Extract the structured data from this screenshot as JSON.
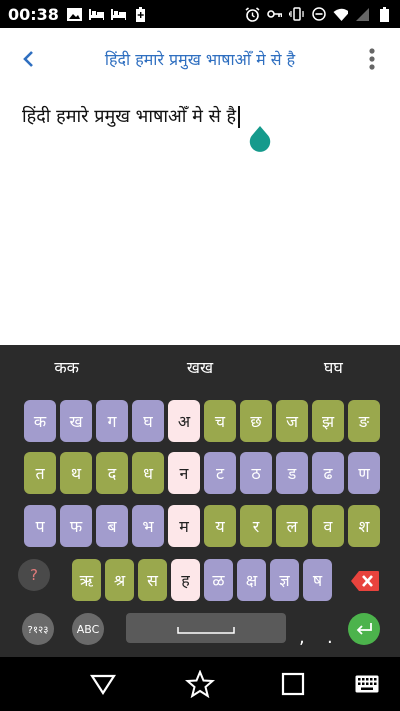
{
  "status_bar": {
    "time": "00:38",
    "left_icons": [
      "image-notification-icon",
      "bed-icon",
      "bed-icon",
      "battery-plus-icon"
    ],
    "right_icons": [
      "alarm-icon",
      "key-icon",
      "vibrate-icon",
      "do-not-disturb-icon",
      "wifi-icon",
      "no-signal-icon",
      "battery-icon"
    ]
  },
  "app_bar": {
    "title": "हिंदी हमारे प्रमुख भाषाओँ मे से है",
    "accent": "#2f6fc0"
  },
  "editor": {
    "text": "हिंदी हमारे प्रमुख भाषाओँ मे से है",
    "handle_color": "#159a8c"
  },
  "keyboard": {
    "suggestions": [
      "कक",
      "खख",
      "घघ"
    ],
    "row1": [
      {
        "label": "क",
        "color": "purple"
      },
      {
        "label": "ख",
        "color": "purple"
      },
      {
        "label": "ग",
        "color": "purple"
      },
      {
        "label": "घ",
        "color": "purple"
      },
      {
        "label": "अ",
        "color": "pink"
      },
      {
        "label": "च",
        "color": "olive"
      },
      {
        "label": "छ",
        "color": "olive"
      },
      {
        "label": "ज",
        "color": "olive"
      },
      {
        "label": "झ",
        "color": "olive"
      },
      {
        "label": "ङ",
        "color": "olive"
      }
    ],
    "row2": [
      {
        "label": "त",
        "color": "olive"
      },
      {
        "label": "थ",
        "color": "olive"
      },
      {
        "label": "द",
        "color": "olive"
      },
      {
        "label": "ध",
        "color": "olive"
      },
      {
        "label": "न",
        "color": "pink"
      },
      {
        "label": "ट",
        "color": "purple"
      },
      {
        "label": "ठ",
        "color": "purple"
      },
      {
        "label": "ड",
        "color": "purple"
      },
      {
        "label": "ढ",
        "color": "purple"
      },
      {
        "label": "ण",
        "color": "purple"
      }
    ],
    "row3": [
      {
        "label": "प",
        "color": "purple"
      },
      {
        "label": "फ",
        "color": "purple"
      },
      {
        "label": "ब",
        "color": "purple"
      },
      {
        "label": "भ",
        "color": "purple"
      },
      {
        "label": "म",
        "color": "pink"
      },
      {
        "label": "य",
        "color": "olive"
      },
      {
        "label": "र",
        "color": "olive"
      },
      {
        "label": "ल",
        "color": "olive"
      },
      {
        "label": "व",
        "color": "olive"
      },
      {
        "label": "श",
        "color": "olive"
      }
    ],
    "row4": [
      {
        "label": "ऋ",
        "color": "olive"
      },
      {
        "label": "श्र",
        "color": "olive"
      },
      {
        "label": "स",
        "color": "olive"
      },
      {
        "label": "ह",
        "color": "pink"
      },
      {
        "label": "ळ",
        "color": "purple"
      },
      {
        "label": "क्ष",
        "color": "purple"
      },
      {
        "label": "ज्ञ",
        "color": "purple"
      },
      {
        "label": "ष",
        "color": "purple"
      }
    ],
    "help_key": "?",
    "numbers_key": "?१२३",
    "abc_key": "ABC",
    "comma_key": ",",
    "period_key": ".",
    "colors": {
      "purple": "#a29ccd",
      "olive": "#9aa84d",
      "pink": "#fde7e9",
      "enter": "#4cb34c",
      "backspace": "#e8433d"
    }
  },
  "nav_bar": {
    "icons": [
      "back-triangle-icon",
      "star-icon",
      "square-icon",
      "keyboard-icon"
    ]
  }
}
